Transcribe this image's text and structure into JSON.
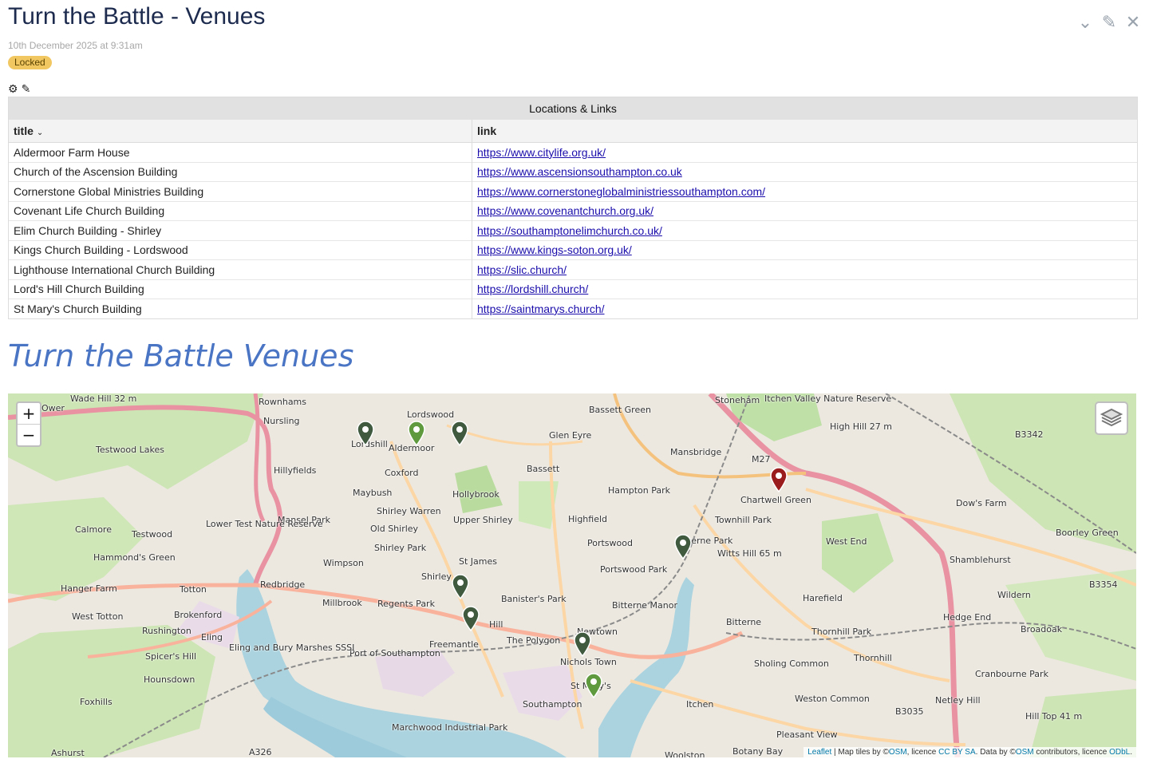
{
  "header": {
    "title": "Turn the Battle - Venues",
    "date": "10th December 2025 at 9:31am",
    "badge": "Locked",
    "actions": [
      "chevron-down-icon",
      "edit-icon",
      "close-icon"
    ]
  },
  "toolbar": {
    "icons": [
      "gear-icon",
      "edit-icon"
    ]
  },
  "table": {
    "caption": "Locations & Links",
    "columns": [
      "title",
      "link"
    ],
    "rows": [
      {
        "title": "Aldermoor Farm House",
        "link": "https://www.citylife.org.uk/"
      },
      {
        "title": "Church of the Ascension Building",
        "link": "https://www.ascensionsouthampton.co.uk"
      },
      {
        "title": "Cornerstone Global Ministries Building",
        "link": "https://www.cornerstoneglobalministriessouthampton.com/"
      },
      {
        "title": "Covenant Life Church Building",
        "link": "https://www.covenantchurch.org.uk/"
      },
      {
        "title": "Elim Church Building - Shirley",
        "link": "https://southamptonelimchurch.co.uk/"
      },
      {
        "title": "Kings Church Building - Lordswood",
        "link": "https://www.kings-soton.org.uk/"
      },
      {
        "title": "Lighthouse International Church Building",
        "link": "https://slic.church/"
      },
      {
        "title": "Lord's Hill Church Building",
        "link": "https://lordshill.church/"
      },
      {
        "title": "St Mary's Church Building",
        "link": "https://saintmarys.church/"
      }
    ]
  },
  "map": {
    "heading": "Turn the Battle Venues",
    "zoom_in": "+",
    "zoom_out": "−",
    "attribution": {
      "leaflet": "Leaflet",
      "text1": " | Map tiles by ©",
      "osm1": "OSM",
      "text2": ", licence ",
      "ccbysa": "CC BY SA",
      "text3": ". Data by ©",
      "osm2": "OSM",
      "text4": " contributors, licence ",
      "odbl": "ODbL",
      "text5": "."
    },
    "places": [
      "Lordswood",
      "Lordshill",
      "Aldermoor",
      "Bassett Green",
      "Glen Eyre",
      "Mansbridge",
      "Nursling",
      "Hillyfields",
      "Coxford",
      "Bassett",
      "Maybush",
      "Hollybrook",
      "Hampton Park",
      "Chartwell Green",
      "Shirley Warren",
      "Old Shirley",
      "Upper Shirley",
      "Highfield",
      "Townhill Park",
      "Mansel Park",
      "Calmore",
      "Testwood",
      "Shirley Park",
      "Portswood",
      "Bitterne Park",
      "West End",
      "Dow's Farm",
      "Boorley Green",
      "Hammond's Green",
      "Wimpson",
      "St James",
      "Portswood Park",
      "Shamblehurst",
      "Redbridge",
      "Shirley",
      "Harefield",
      "Wildern",
      "Hanger Farm",
      "Totton",
      "Millbrook",
      "Regents Park",
      "Banister's Park",
      "Bitterne Manor",
      "Hedge End",
      "Broadoak",
      "West Totton",
      "Brokenford",
      "Hill",
      "Bitterne",
      "Rushington",
      "Freemantle",
      "Newtown",
      "Thornhill Park",
      "Eling",
      "The Polygon",
      "Nichols Town",
      "Thornhill",
      "Sholing Common",
      "Spicer's Hill",
      "Port of Southampton",
      "Cranbourne Park",
      "Hounsdown",
      "St Mary's",
      "Southampton",
      "Weston Common",
      "Netley Hill",
      "Foxhills",
      "Itchen",
      "Pleasant View",
      "Ashurst",
      "Botany Bay",
      "Woolston",
      "Marchwood Industrial Park",
      "Testwood Lakes",
      "Lower Test Nature Reserve",
      "Eling and Bury Marshes SSSI",
      "Witts Hill 65 m",
      "High Hill 27 m",
      "Hill Top 41 m",
      "Wade Hill 32 m",
      "Stoneham",
      "Itchen Valley Nature Reserve",
      "Rownhams",
      "Ower",
      "M27",
      "B3342",
      "B3354",
      "B3035",
      "A326"
    ],
    "markers": [
      {
        "name": "Lord's Hill Church Building",
        "color": "#3f5a3f"
      },
      {
        "name": "Aldermoor Farm House",
        "color": "#5f9a3f"
      },
      {
        "name": "Kings Church Building - Lordswood",
        "color": "#3f5a3f"
      },
      {
        "name": "Church of the Ascension Building",
        "color": "#9b1c1c"
      },
      {
        "name": "Covenant Life Church Building",
        "color": "#3f5a3f"
      },
      {
        "name": "Elim Church Building - Shirley",
        "color": "#3f5a3f"
      },
      {
        "name": "Lighthouse International Church Building",
        "color": "#3f5a3f"
      },
      {
        "name": "Cornerstone Global Ministries Building",
        "color": "#3f5a3f"
      },
      {
        "name": "St Mary's Church Building",
        "color": "#5f9a3f"
      }
    ]
  }
}
